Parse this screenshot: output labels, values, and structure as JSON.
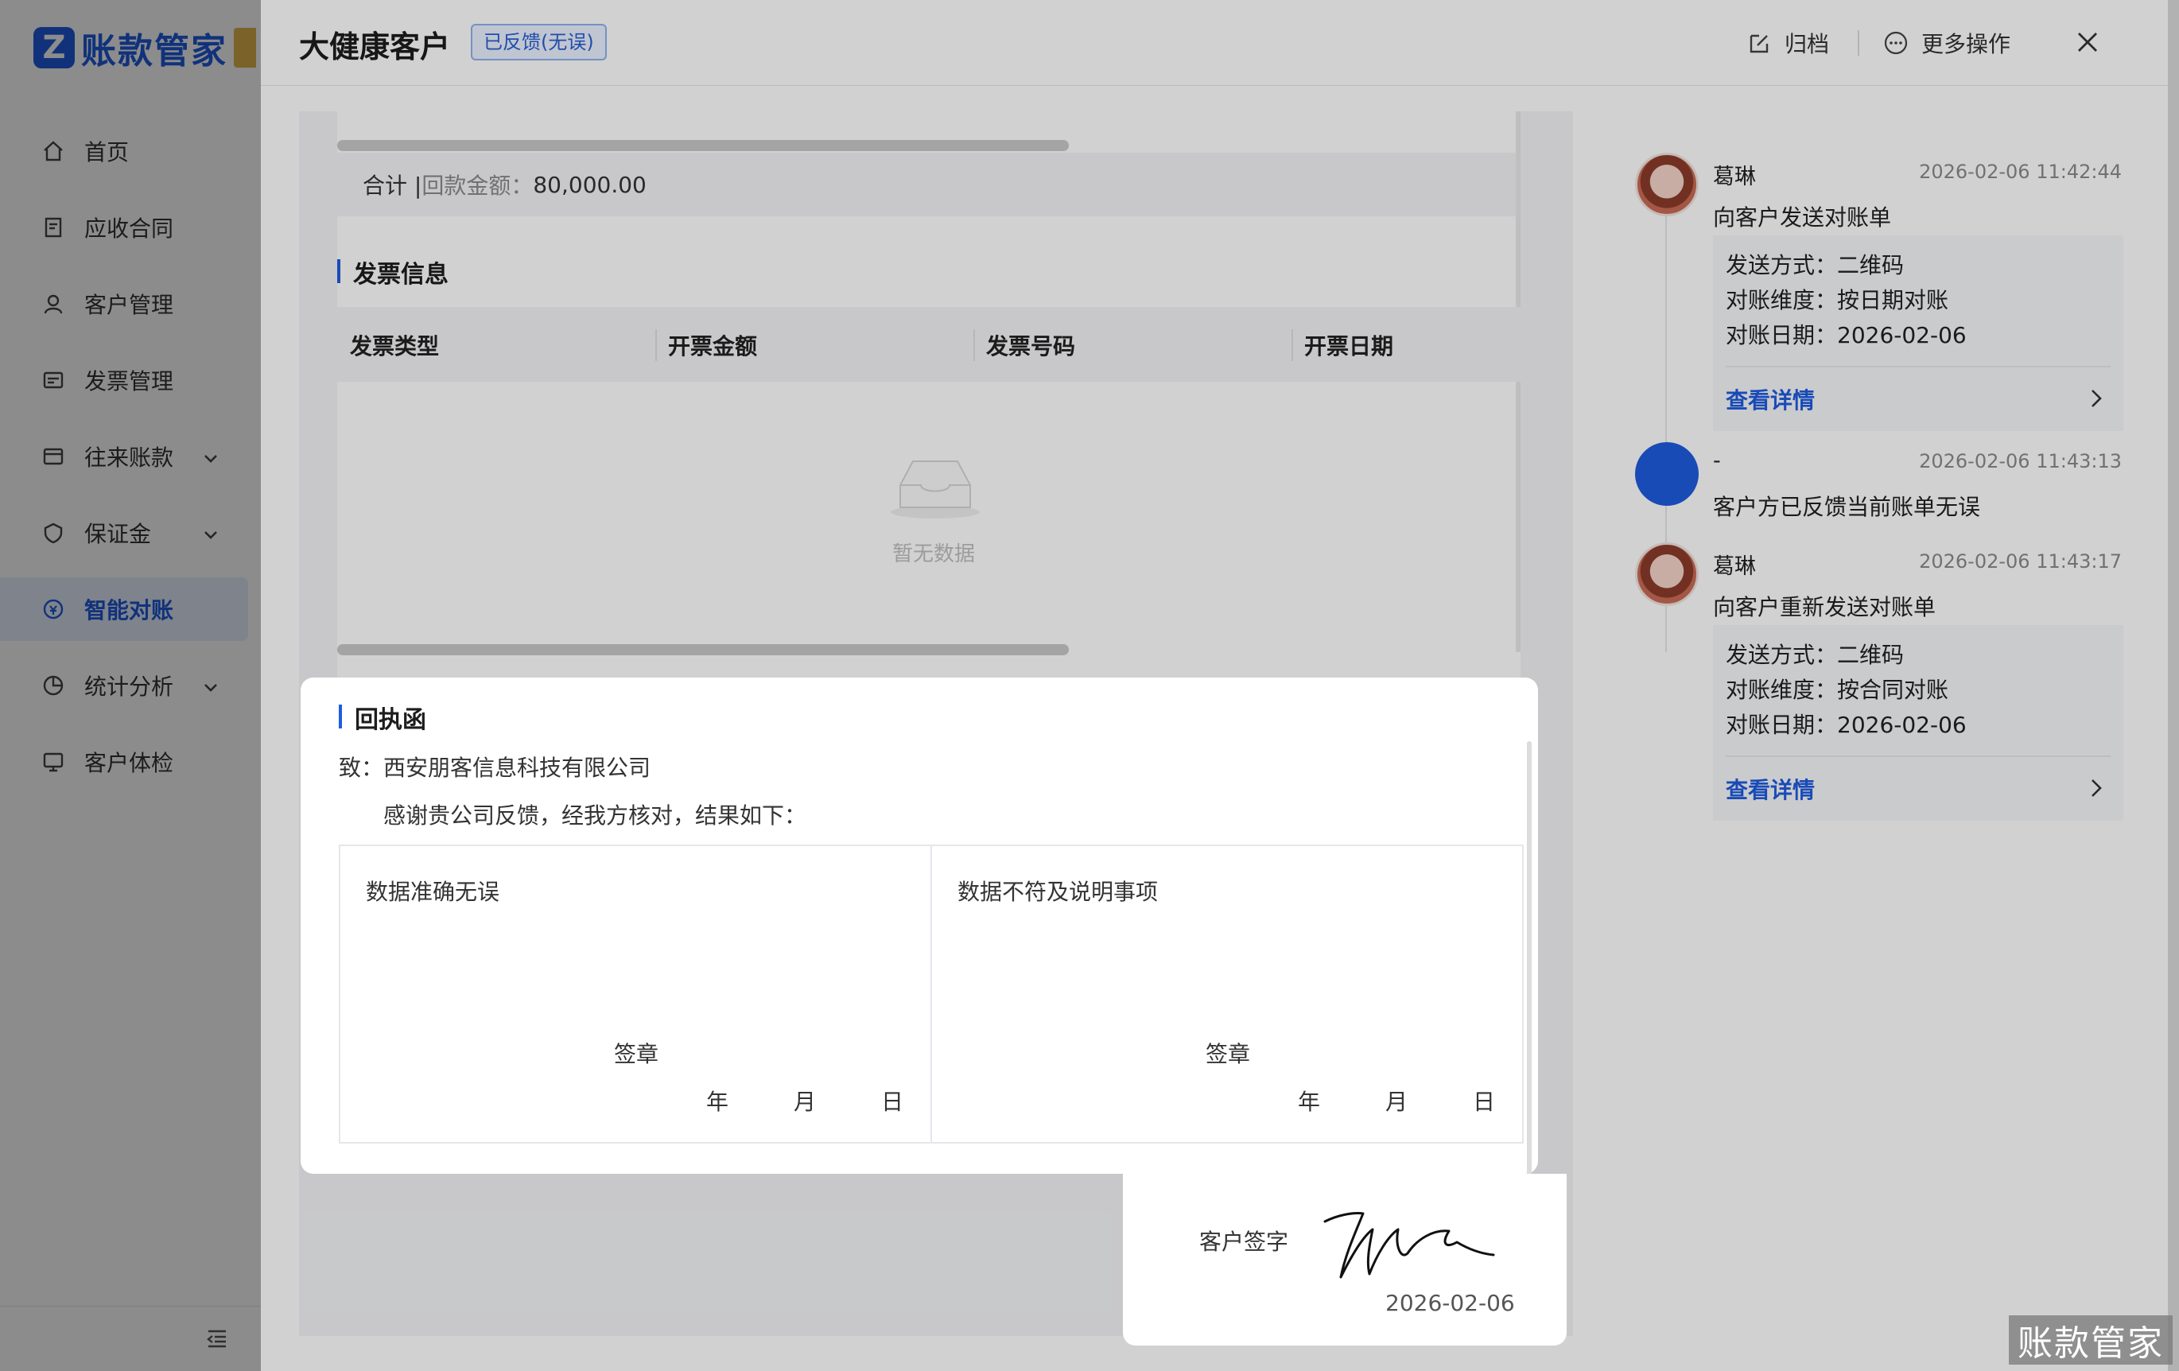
{
  "app": {
    "logo_text": "账款管家"
  },
  "sidebar": {
    "items": [
      {
        "label": "首页",
        "icon": "home-icon"
      },
      {
        "label": "应收合同",
        "icon": "contract-icon"
      },
      {
        "label": "客户管理",
        "icon": "user-icon"
      },
      {
        "label": "发票管理",
        "icon": "invoice-icon"
      },
      {
        "label": "往来账款",
        "icon": "ledger-icon",
        "expandable": true
      },
      {
        "label": "保证金",
        "icon": "shield-icon",
        "expandable": true
      },
      {
        "label": "智能对账",
        "icon": "reconcile-icon",
        "active": true
      },
      {
        "label": "统计分析",
        "icon": "chart-pie-icon",
        "expandable": true
      },
      {
        "label": "客户体检",
        "icon": "monitor-icon"
      }
    ]
  },
  "drawer": {
    "title": "大健康客户",
    "status": "已反馈(无误)",
    "actions": {
      "archive": "归档",
      "more": "更多操作"
    },
    "total": {
      "prefix": "合计 | ",
      "label": "回款金额：",
      "value": "80,000.00"
    },
    "invoice": {
      "title": "发票信息",
      "columns": [
        "发票类型",
        "开票金额",
        "发票号码",
        "开票日期"
      ],
      "empty": "暂无数据"
    },
    "receipt": {
      "title": "回执函",
      "to": "致：西安朋客信息科技有限公司",
      "thanks": "感谢贵公司反馈，经我方核对，结果如下：",
      "left_label": "数据准确无误",
      "right_label": "数据不符及说明事项",
      "seal": "签章",
      "year": "年",
      "month": "月",
      "day": "日"
    },
    "signature": {
      "label": "客户签字",
      "date": "2026-02-06"
    }
  },
  "timeline": [
    {
      "name": "葛琳",
      "time": "2026-02-06 11:42:44",
      "desc": "向客户发送对账单",
      "details": [
        "发送方式：二维码",
        "对账维度：按日期对账",
        "对账日期：2026-02-06"
      ],
      "link": "查看详情"
    },
    {
      "name": "-",
      "time": "2026-02-06 11:43:13",
      "desc": "客户方已反馈当前账单无误"
    },
    {
      "name": "葛琳",
      "time": "2026-02-06 11:43:17",
      "desc": "向客户重新发送对账单",
      "details": [
        "发送方式：二维码",
        "对账维度：按合同对账",
        "对账日期：2026-02-06"
      ],
      "link": "查看详情"
    }
  ],
  "watermark": "账款管家",
  "colors": {
    "accent": "#1f5ce0",
    "tag_bg": "#eaf1ff"
  }
}
